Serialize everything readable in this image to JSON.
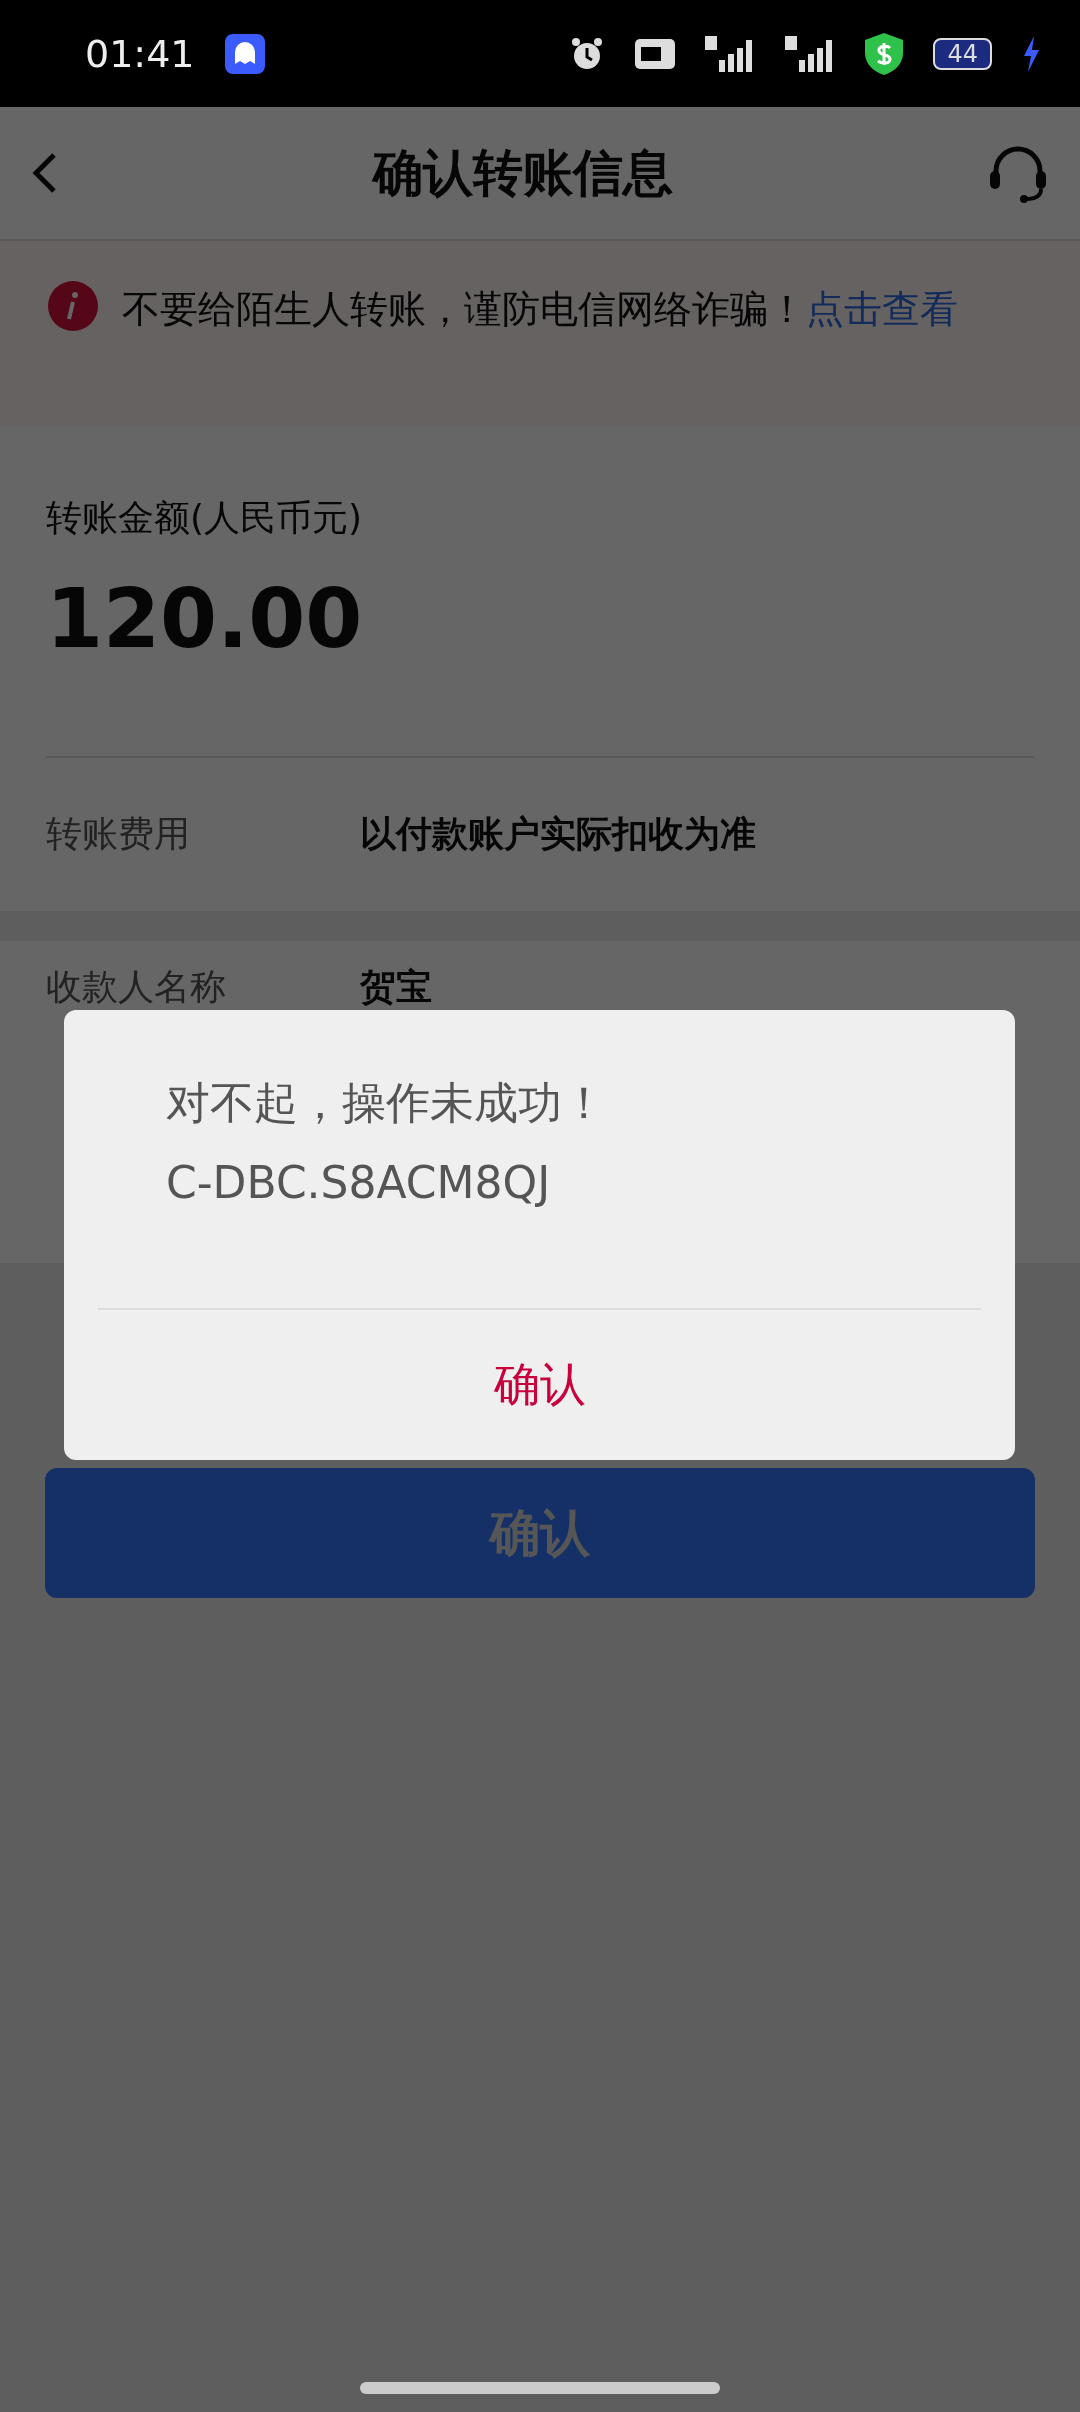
{
  "status_bar": {
    "time": "01:41",
    "battery": "44"
  },
  "header": {
    "title": "确认转账信息"
  },
  "warning": {
    "text": "不要给陌生人转账，谨防电信网络诈骗！",
    "link": "点击查看"
  },
  "amount": {
    "label": "转账金额(人民币元)",
    "value": "120.00"
  },
  "fee": {
    "label": "转账费用",
    "value": "以付款账户实际扣收为准"
  },
  "payee_rows": [
    {
      "label": "收款人名称",
      "value": "贺宝"
    }
  ],
  "confirm_button": {
    "label": "确认"
  },
  "dialog": {
    "lines": [
      "对不起，操作未成功！",
      "C-DBC.S8ACM8QJ"
    ],
    "button": "确认"
  }
}
